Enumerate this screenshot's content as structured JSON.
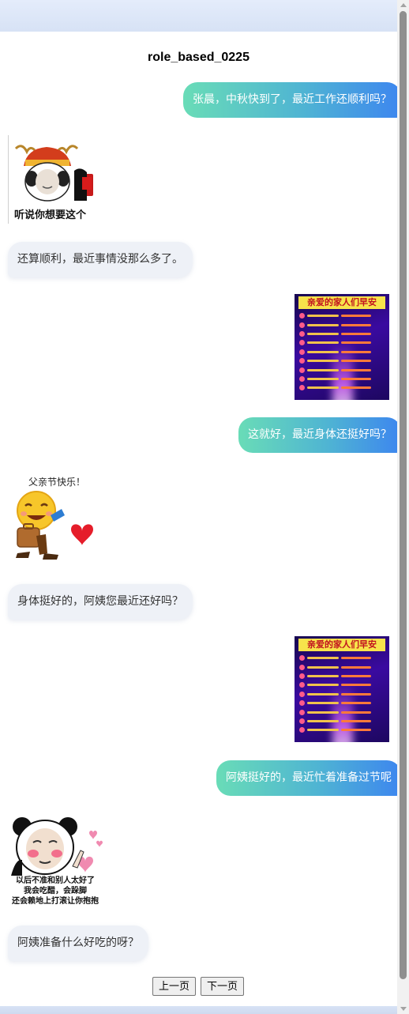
{
  "page": {
    "title": "role_based_0225"
  },
  "messages": [
    {
      "role": "user",
      "type": "text",
      "text": "张晨，中秋快到了，最近工作还顺利吗？"
    },
    {
      "role": "assistant",
      "type": "sticker",
      "caption": "听说你想要这个"
    },
    {
      "role": "assistant",
      "type": "text",
      "text": "还算顺利，最近事情没那么多了。"
    },
    {
      "role": "user",
      "type": "image",
      "poster_title": "亲爱的家人们早安"
    },
    {
      "role": "user",
      "type": "text",
      "text": "这就好，最近身体还挺好吗？"
    },
    {
      "role": "assistant",
      "type": "sticker",
      "caption": "父亲节快乐！"
    },
    {
      "role": "assistant",
      "type": "text",
      "text": "身体挺好的，阿姨您最近还好吗？"
    },
    {
      "role": "user",
      "type": "image",
      "poster_title": "亲爱的家人们早安"
    },
    {
      "role": "user",
      "type": "text",
      "text": "阿姨挺好的，最近忙着准备过节呢"
    },
    {
      "role": "assistant",
      "type": "sticker",
      "caption_lines": [
        "以后不准和别人太好了",
        "我会吃醋，会跺脚",
        "还会赖地上打滚让你抱抱"
      ]
    },
    {
      "role": "assistant",
      "type": "text",
      "text": "阿姨准备什么好吃的呀？"
    }
  ],
  "pagination": {
    "prev_label": "上一页",
    "next_label": "下一页"
  },
  "colors": {
    "user_bubble_gradient": [
      "#69dcb7",
      "#3d86ef"
    ],
    "assistant_bubble": "#eef1f7",
    "page_background": "#dfe7f6"
  }
}
